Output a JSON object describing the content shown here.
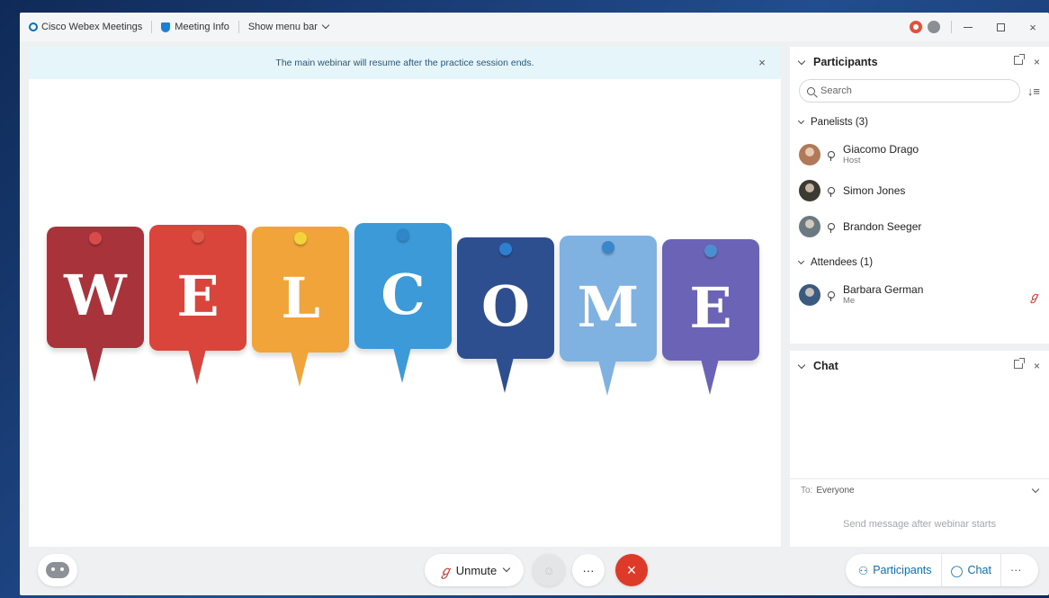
{
  "titlebar": {
    "app_name": "Cisco Webex Meetings",
    "meeting_info": "Meeting Info",
    "show_menu_bar": "Show menu bar",
    "minimize": "—",
    "maximize": "",
    "close": "×"
  },
  "stage": {
    "banner_text": "The main webinar will resume after the practice session ends.",
    "banner_close": "×",
    "welcome_letters": [
      {
        "letter": "W",
        "color": "#a8333a",
        "pin": "#d84b4b"
      },
      {
        "letter": "E",
        "color": "#d9453b",
        "pin": "#e05a4a"
      },
      {
        "letter": "L",
        "color": "#f0a43a",
        "pin": "#f3d23a"
      },
      {
        "letter": "C",
        "color": "#3c9ad8",
        "pin": "#2f86c9"
      },
      {
        "letter": "O",
        "color": "#2e4f8f",
        "pin": "#2f7fd0"
      },
      {
        "letter": "M",
        "color": "#7fb2e0",
        "pin": "#3a86c8"
      },
      {
        "letter": "E",
        "color": "#6b63b5",
        "pin": "#4b8fd0"
      }
    ]
  },
  "bottombar": {
    "unmute_label": "Unmute",
    "unmute_icon": "mic-muted-icon",
    "more_label": "···",
    "end_label": "×",
    "participants_label": "Participants",
    "chat_label": "Chat",
    "overflow_label": "···"
  },
  "participants": {
    "title": "Participants",
    "search_placeholder": "Search",
    "sort_glyph": "↓≡",
    "panelists_header": "Panelists (3)",
    "panelists": [
      {
        "name": "Giacomo Drago",
        "role": "Host",
        "avatar_color": "#b07a5a"
      },
      {
        "name": "Simon Jones",
        "role": "",
        "avatar_color": "#3d3a33"
      },
      {
        "name": "Brandon Seeger",
        "role": "",
        "avatar_color": "#6b7a80"
      }
    ],
    "attendees_header": "Attendees (1)",
    "attendees": [
      {
        "name": "Barbara German",
        "role": "Me",
        "avatar_color": "#3a5a80",
        "muted_glyph": "ℊ"
      }
    ]
  },
  "chat": {
    "title": "Chat",
    "to_label": "To:",
    "to_value": "Everyone",
    "input_placeholder": "Send message after webinar starts"
  }
}
